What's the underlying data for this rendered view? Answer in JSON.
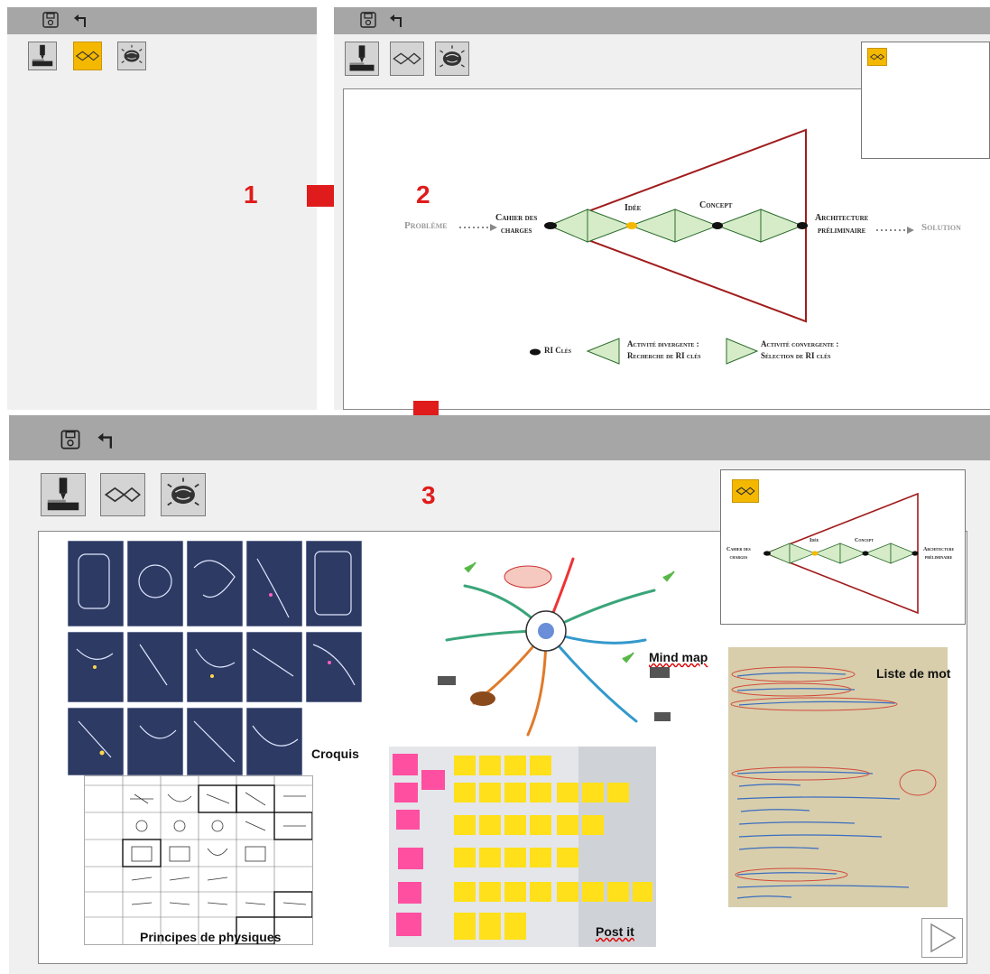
{
  "steps": {
    "one": "1",
    "two": "2",
    "three": "3"
  },
  "icons": {
    "save": "save-icon",
    "undo": "undo-arrow-icon",
    "tool1": "cutting-tool-icon",
    "tool2": "double-diamond-icon",
    "tool3": "brain-icon"
  },
  "colors": {
    "active_tool": "#f5b800",
    "arrow": "#e01b1b",
    "triangle_stroke": "#a01c1c",
    "diamond_fill": "#d6ecc9"
  },
  "diagram": {
    "probleme": "Problème",
    "cahier_line1": "Cahier des",
    "cahier_line2": "charges",
    "idee": "Idée",
    "concept": "Concept",
    "archi_line1": "Architecture",
    "archi_line2": "préliminaire",
    "solution": "Solution",
    "legend_dot": "RI Clés",
    "legend_div_line1": "Activité divergente :",
    "legend_div_line2": "Recherche de RI clés",
    "legend_conv_line1": "Activité convergente :",
    "legend_conv_line2": "Sélection de RI clés"
  },
  "mini_diagram": {
    "cahier_line1": "Cahier des",
    "cahier_line2": "charges",
    "idee": "Idée",
    "concept": "Concept",
    "archi_line1": "Architecture",
    "archi_line2": "préliminaire"
  },
  "workspace": {
    "croquis": "Croquis",
    "mind_map": "Mind map",
    "liste_de_mot": "Liste de mot",
    "principes": "Principes de physiques",
    "post_it": "Post it"
  },
  "navigation": {
    "next": "play-triangle-icon"
  }
}
